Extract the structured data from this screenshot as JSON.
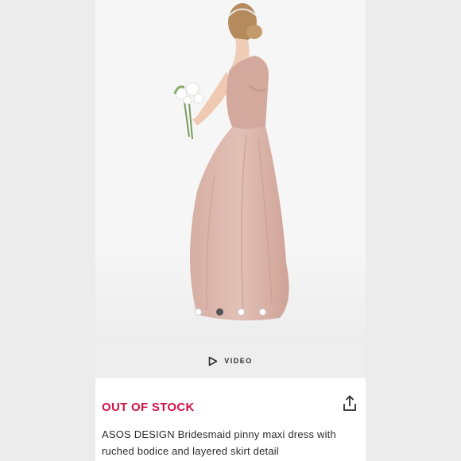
{
  "gallery": {
    "image_alt": "Model wearing blush pink maxi dress holding white flower bouquet",
    "dots_count": 4,
    "active_dot": 1
  },
  "video": {
    "label": "VIDEO",
    "icon": "play-icon"
  },
  "product": {
    "stock_status": "OUT OF STOCK",
    "title": "ASOS DESIGN Bridesmaid pinny maxi dress with ruched bodice and layered skirt detail",
    "share_icon": "share-icon"
  },
  "colors": {
    "stock_red": "#d01345",
    "dress_pink": "#d8b1a6",
    "text_dark": "#2d2d2d"
  }
}
